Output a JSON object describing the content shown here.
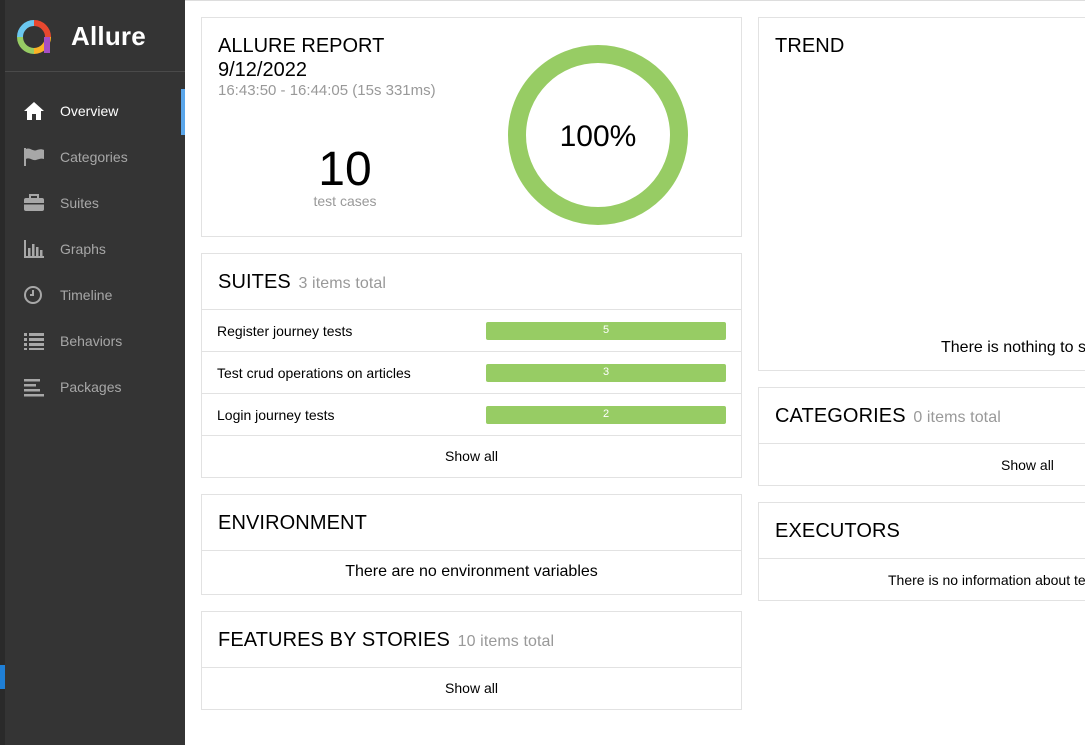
{
  "brand": {
    "name": "Allure"
  },
  "nav": {
    "items": [
      {
        "label": "Overview",
        "icon": "home-icon",
        "active": true
      },
      {
        "label": "Categories",
        "icon": "flag-icon"
      },
      {
        "label": "Suites",
        "icon": "briefcase-icon"
      },
      {
        "label": "Graphs",
        "icon": "bar-chart-icon"
      },
      {
        "label": "Timeline",
        "icon": "clock-icon"
      },
      {
        "label": "Behaviors",
        "icon": "list-icon"
      },
      {
        "label": "Packages",
        "icon": "align-left-icon"
      }
    ]
  },
  "summary": {
    "title": "ALLURE REPORT",
    "date": "9/12/2022",
    "time_range": "16:43:50 - 16:44:05 (15s 331ms)",
    "test_count": "10",
    "test_count_label": "test cases",
    "pass_rate": "100%",
    "pass_fraction": 1.0
  },
  "suites": {
    "title": "SUITES",
    "subtitle": "3 items total",
    "rows": [
      {
        "name": "Register journey tests",
        "count": "5"
      },
      {
        "name": "Test crud operations on articles",
        "count": "3"
      },
      {
        "name": "Login journey tests",
        "count": "2"
      }
    ],
    "show_all": "Show all"
  },
  "environment": {
    "title": "ENVIRONMENT",
    "message": "There are no environment variables"
  },
  "features": {
    "title": "FEATURES BY STORIES",
    "subtitle": "10 items total",
    "show_all": "Show all"
  },
  "trend": {
    "title": "TREND",
    "message": "There is nothing to s"
  },
  "categories": {
    "title": "CATEGORIES",
    "subtitle": "0 items total",
    "show_all": "Show all"
  },
  "executors": {
    "title": "EXECUTORS",
    "message": "There is no information about te"
  },
  "colors": {
    "sidebar_bg": "#343434",
    "passed": "#97cc64",
    "active_indicator": "#5aa6ea"
  }
}
